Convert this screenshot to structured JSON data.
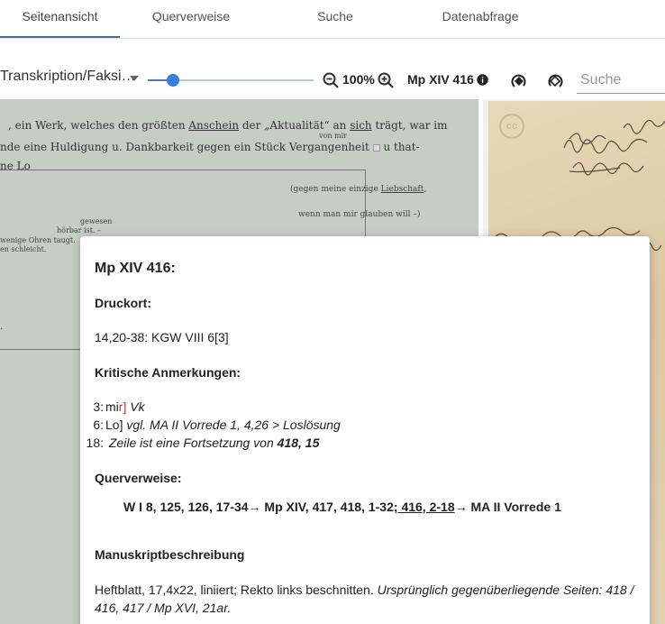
{
  "tabs": [
    {
      "label": "Seitenansicht"
    },
    {
      "label": "Querverweise"
    },
    {
      "label": "Suche"
    },
    {
      "label": "Datenabfrage"
    }
  ],
  "toolbar": {
    "view_select": "Transkription/Faksi…",
    "zoom_level": "100%",
    "zoom_fraction": 0.15,
    "manuscript_id": "Mp XIV 416",
    "search_placeholder": "Suche"
  },
  "transcription": {
    "line1_a": ", ein Werk, welches den größten ",
    "line1_anschein": "Anschein",
    "line1_b": " der „Aktualität“ an ",
    "line1_sich": "sich",
    "line1_c": " trägt, war im",
    "line2": "nde eine Huldigung u. Dankbarkeit gegen ein Stück Vergangenheit",
    "line2_end": "u that-",
    "line2_above": "von mir",
    "line3": "ne Lo",
    "box_line1_a": "(gegen meine einzige ",
    "box_line1_b": "Liebschaft",
    "box_line1_c": ",",
    "box_line2": "wenn man mir glauben will –)",
    "margin_1": "gewesen",
    "margin_2": "hörbar ist. –",
    "margin_3": "wenige Ohren taugt.",
    "margin_4": "en schleicht."
  },
  "facsimile": {
    "cc_label": "cc"
  },
  "popup": {
    "title": "Mp XIV 416:",
    "druckort_heading": "Druckort:",
    "druckort_text": "14,20-38: KGW VIII 6[3]",
    "krit_heading": "Kritische Anmerkungen:",
    "notes": [
      {
        "num": "3:",
        "lemma": "mi",
        "lemma_red": "r]",
        "text": " Vk"
      },
      {
        "num": "6:",
        "lemma": "Lo]",
        "text": " vgl. MA II Vorrede 1, 4,26 > Loslösung"
      },
      {
        "num": "18:",
        "lemma": "",
        "text": "Zeile ist eine Fortsetzung von ",
        "bold_ref": "418, 15"
      }
    ],
    "querverweise_heading": "Querverweise:",
    "qv_a": "W I 8, 125, 126, 17-34",
    "qv_arrow1": "→",
    "qv_b": " Mp XIV, 417, 418, 1-32",
    "qv_link": "; 416, 2-18",
    "qv_arrow2": "→",
    "qv_c": " MA II Vorrede 1",
    "manuskript_heading": "Manuskriptbeschreibung",
    "desc_plain": "Heftblatt, 17,4x22, liniiert; Rekto links beschnitten. ",
    "desc_italic": "Ursprünglich gegenüberliegende Seiten: 418 / 416, 417 / Mp XVI, 21ar."
  }
}
